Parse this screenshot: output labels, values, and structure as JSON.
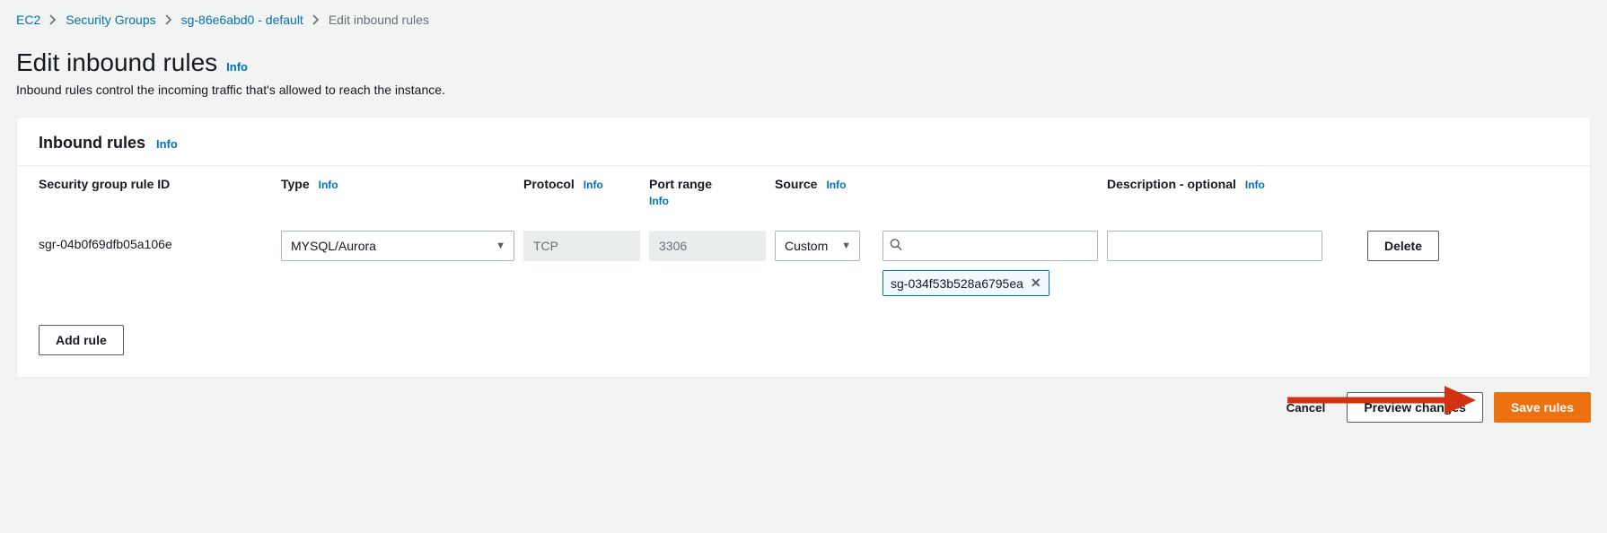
{
  "breadcrumb": {
    "items": [
      "EC2",
      "Security Groups",
      "sg-86e6abd0 - default"
    ],
    "current": "Edit inbound rules"
  },
  "page": {
    "title": "Edit inbound rules",
    "info": "Info",
    "subtitle": "Inbound rules control the incoming traffic that's allowed to reach the instance."
  },
  "panel": {
    "title": "Inbound rules",
    "info": "Info",
    "columns": {
      "rule_id": "Security group rule ID",
      "type": "Type",
      "protocol": "Protocol",
      "port_range": "Port range",
      "source": "Source",
      "description": "Description - optional"
    },
    "info_label": "Info",
    "rows": [
      {
        "rule_id": "sgr-04b0f69dfb05a106e",
        "type": "MYSQL/Aurora",
        "protocol": "TCP",
        "port_range": "3306",
        "source_mode": "Custom",
        "source_search": "",
        "source_tokens": [
          "sg-034f53b528a6795ea"
        ],
        "description": "",
        "delete_label": "Delete"
      }
    ],
    "add_rule_label": "Add rule"
  },
  "footer": {
    "cancel": "Cancel",
    "preview": "Preview changes",
    "save": "Save rules"
  }
}
